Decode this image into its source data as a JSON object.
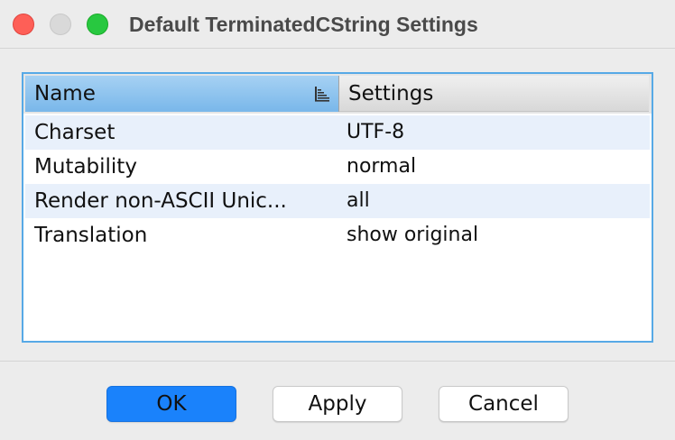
{
  "window": {
    "title": "Default TerminatedCString Settings",
    "controls": [
      "close",
      "minimize",
      "zoom"
    ]
  },
  "table": {
    "columns": [
      {
        "label": "Name",
        "sort_icon": "sort-ascending-icon"
      },
      {
        "label": "Settings"
      }
    ],
    "rows": [
      {
        "name": "Charset",
        "value": "UTF-8"
      },
      {
        "name": "Mutability",
        "value": "normal"
      },
      {
        "name": "Render non-ASCII Unic...",
        "value": "all"
      },
      {
        "name": "Translation",
        "value": "show original"
      }
    ]
  },
  "buttons": {
    "ok": "OK",
    "apply": "Apply",
    "cancel": "Cancel"
  },
  "colors": {
    "accent": "#1a82fb",
    "selected_header": "#79b7ea",
    "table_border": "#57a9e6",
    "alt_row": "#e8f0fb"
  }
}
